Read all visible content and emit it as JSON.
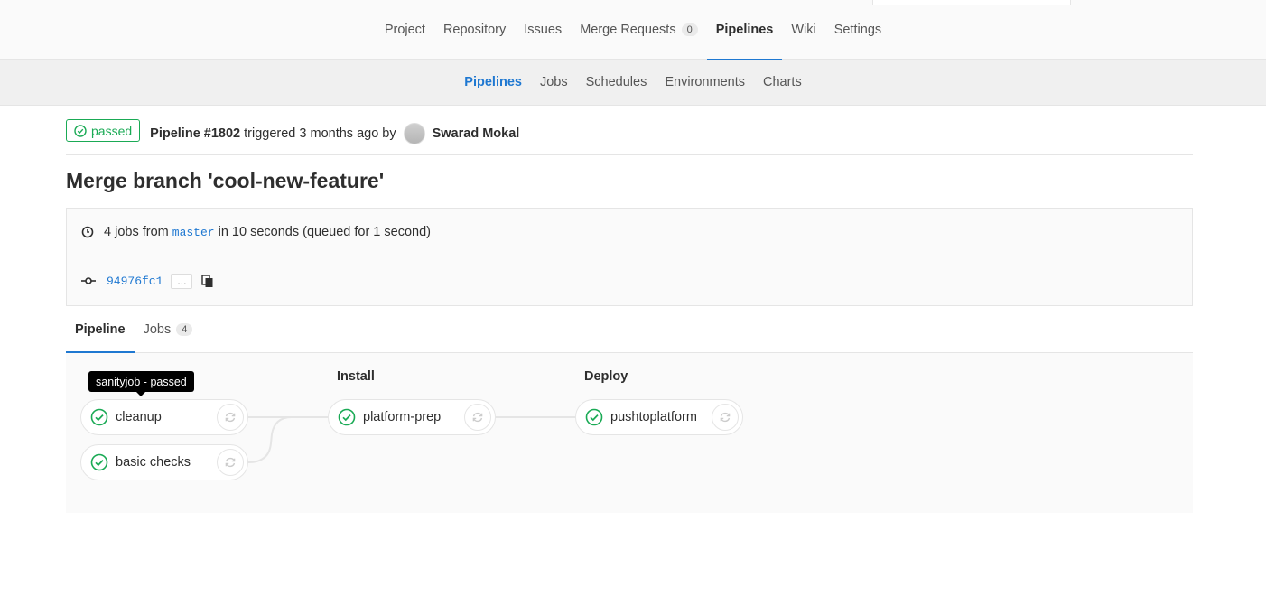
{
  "topnav": {
    "items": [
      {
        "label": "Project"
      },
      {
        "label": "Repository"
      },
      {
        "label": "Issues"
      },
      {
        "label": "Merge Requests",
        "count": "0"
      },
      {
        "label": "Pipelines"
      },
      {
        "label": "Wiki"
      },
      {
        "label": "Settings"
      }
    ],
    "active": "Pipelines"
  },
  "subnav": {
    "items": [
      "Pipelines",
      "Jobs",
      "Schedules",
      "Environments",
      "Charts"
    ],
    "active": "Pipelines"
  },
  "pipeline": {
    "status": "passed",
    "id_label": "Pipeline #1802",
    "triggered_text": "triggered 3 months ago by",
    "user": "Swarad Mokal",
    "title": "Merge branch 'cool-new-feature'",
    "jobs_text_prefix": "4 jobs from",
    "branch": "master",
    "jobs_text_suffix": "in 10 seconds (queued for 1 second)",
    "commit_sha": "94976fc1",
    "ellipsis": "..."
  },
  "tabs": {
    "pipeline_label": "Pipeline",
    "jobs_label": "Jobs",
    "jobs_count": "4"
  },
  "graph": {
    "tooltip": "sanityjob - passed",
    "stages": [
      {
        "title": "",
        "jobs": [
          "cleanup",
          "basic checks"
        ]
      },
      {
        "title": "Install",
        "jobs": [
          "platform-prep"
        ]
      },
      {
        "title": "Deploy",
        "jobs": [
          "pushtoplatform"
        ]
      }
    ]
  },
  "colors": {
    "success": "#1aaa55",
    "link": "#1f78d1",
    "active_tab": "#1f78d1"
  }
}
